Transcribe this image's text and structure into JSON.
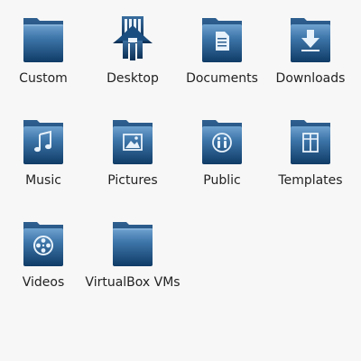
{
  "folders": [
    {
      "label": "Custom",
      "icon": "folder-icon"
    },
    {
      "label": "Desktop",
      "icon": "desktop-folder-icon"
    },
    {
      "label": "Documents",
      "icon": "documents-folder-icon"
    },
    {
      "label": "Downloads",
      "icon": "downloads-folder-icon"
    },
    {
      "label": "Music",
      "icon": "music-folder-icon"
    },
    {
      "label": "Pictures",
      "icon": "pictures-folder-icon"
    },
    {
      "label": "Public",
      "icon": "public-folder-icon"
    },
    {
      "label": "Templates",
      "icon": "templates-folder-icon"
    },
    {
      "label": "Videos",
      "icon": "videos-folder-icon"
    },
    {
      "label": "VirtualBox VMs",
      "icon": "folder-icon"
    }
  ],
  "colors": {
    "folder_dark": "#0e3a64",
    "folder_light": "#5d93c5",
    "emblem": "#e8f2fb",
    "text": "#222222",
    "background": "#f7f7f7"
  }
}
